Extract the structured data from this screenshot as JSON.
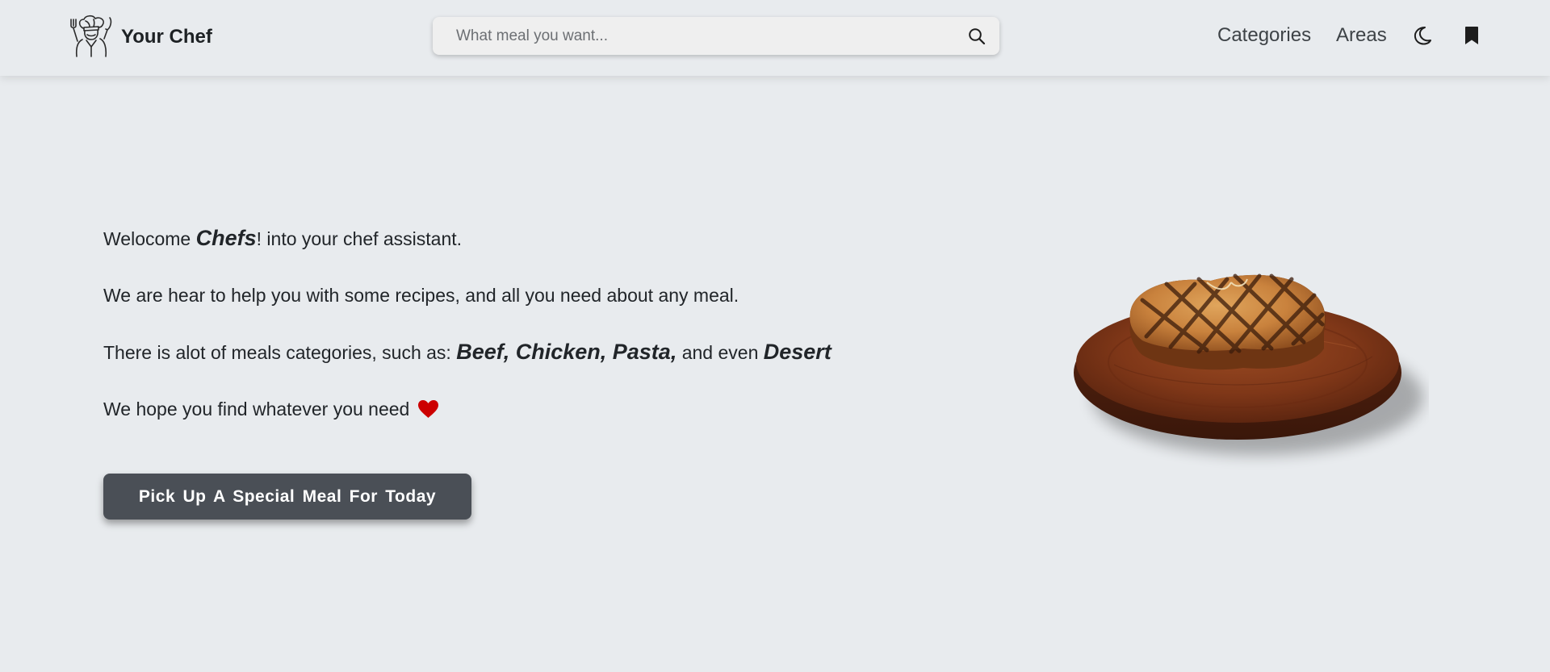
{
  "navbar": {
    "brand": "Your Chef",
    "search_placeholder": "What meal you want...",
    "links": {
      "categories": "Categories",
      "areas": "Areas"
    },
    "icons": [
      "chef-logo-icon",
      "search-icon",
      "moon-icon",
      "bookmark-icon"
    ]
  },
  "hero": {
    "line1": {
      "a": "Welocome ",
      "b": "Chefs",
      "c": "! into your chef assistant."
    },
    "line2": "We are hear to help you with some recipes, and all you need about any meal.",
    "line3": {
      "a": "There is alot of meals categories, such as: ",
      "b": "Beef, Chicken, Pasta,",
      "c": " and even ",
      "d": "Desert"
    },
    "line4": "We hope you find whatever you need",
    "cta": "Pick Up A Special Meal For Today",
    "image": "steak-on-wooden-board"
  },
  "colors": {
    "background": "#e8ebee",
    "button": "#4a4f56",
    "heart": "#cc0000",
    "text": "#212529"
  }
}
